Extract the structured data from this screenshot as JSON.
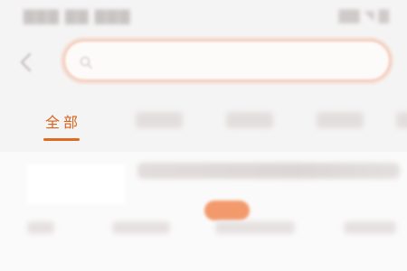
{
  "search": {
    "placeholder": ""
  },
  "tabs": [
    {
      "label": "全部",
      "active": true
    }
  ],
  "colors": {
    "accent": "#dd6a22",
    "badge": "#f39a6c",
    "search_border": "#f3c6b3",
    "background": "#f5f4f4"
  },
  "icons": {
    "back": "chevron-left-icon",
    "search": "search-icon"
  }
}
